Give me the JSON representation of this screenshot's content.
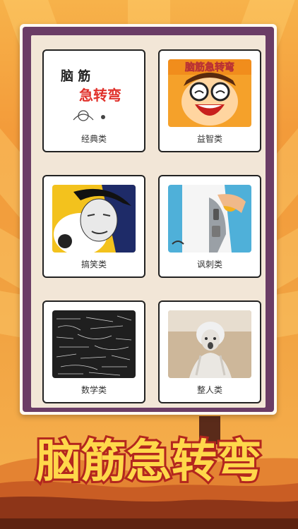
{
  "app": {
    "title": "脑筋急转弯"
  },
  "categories": [
    {
      "label": "经典类",
      "image_text_line1": "脑 筋",
      "image_text_line2": "急转弯"
    },
    {
      "label": "益智类",
      "image_text": "脑筋急转弯"
    },
    {
      "label": "搞笑类"
    },
    {
      "label": "讽刺类"
    },
    {
      "label": "数学类"
    },
    {
      "label": "整人类"
    }
  ],
  "colors": {
    "frame_purple": "#6b3d66",
    "panel_beige": "#f2e6d7",
    "banner_red": "#d8362a",
    "banner_yellow": "#ffd84a",
    "background_orange": "#f39b3a"
  }
}
